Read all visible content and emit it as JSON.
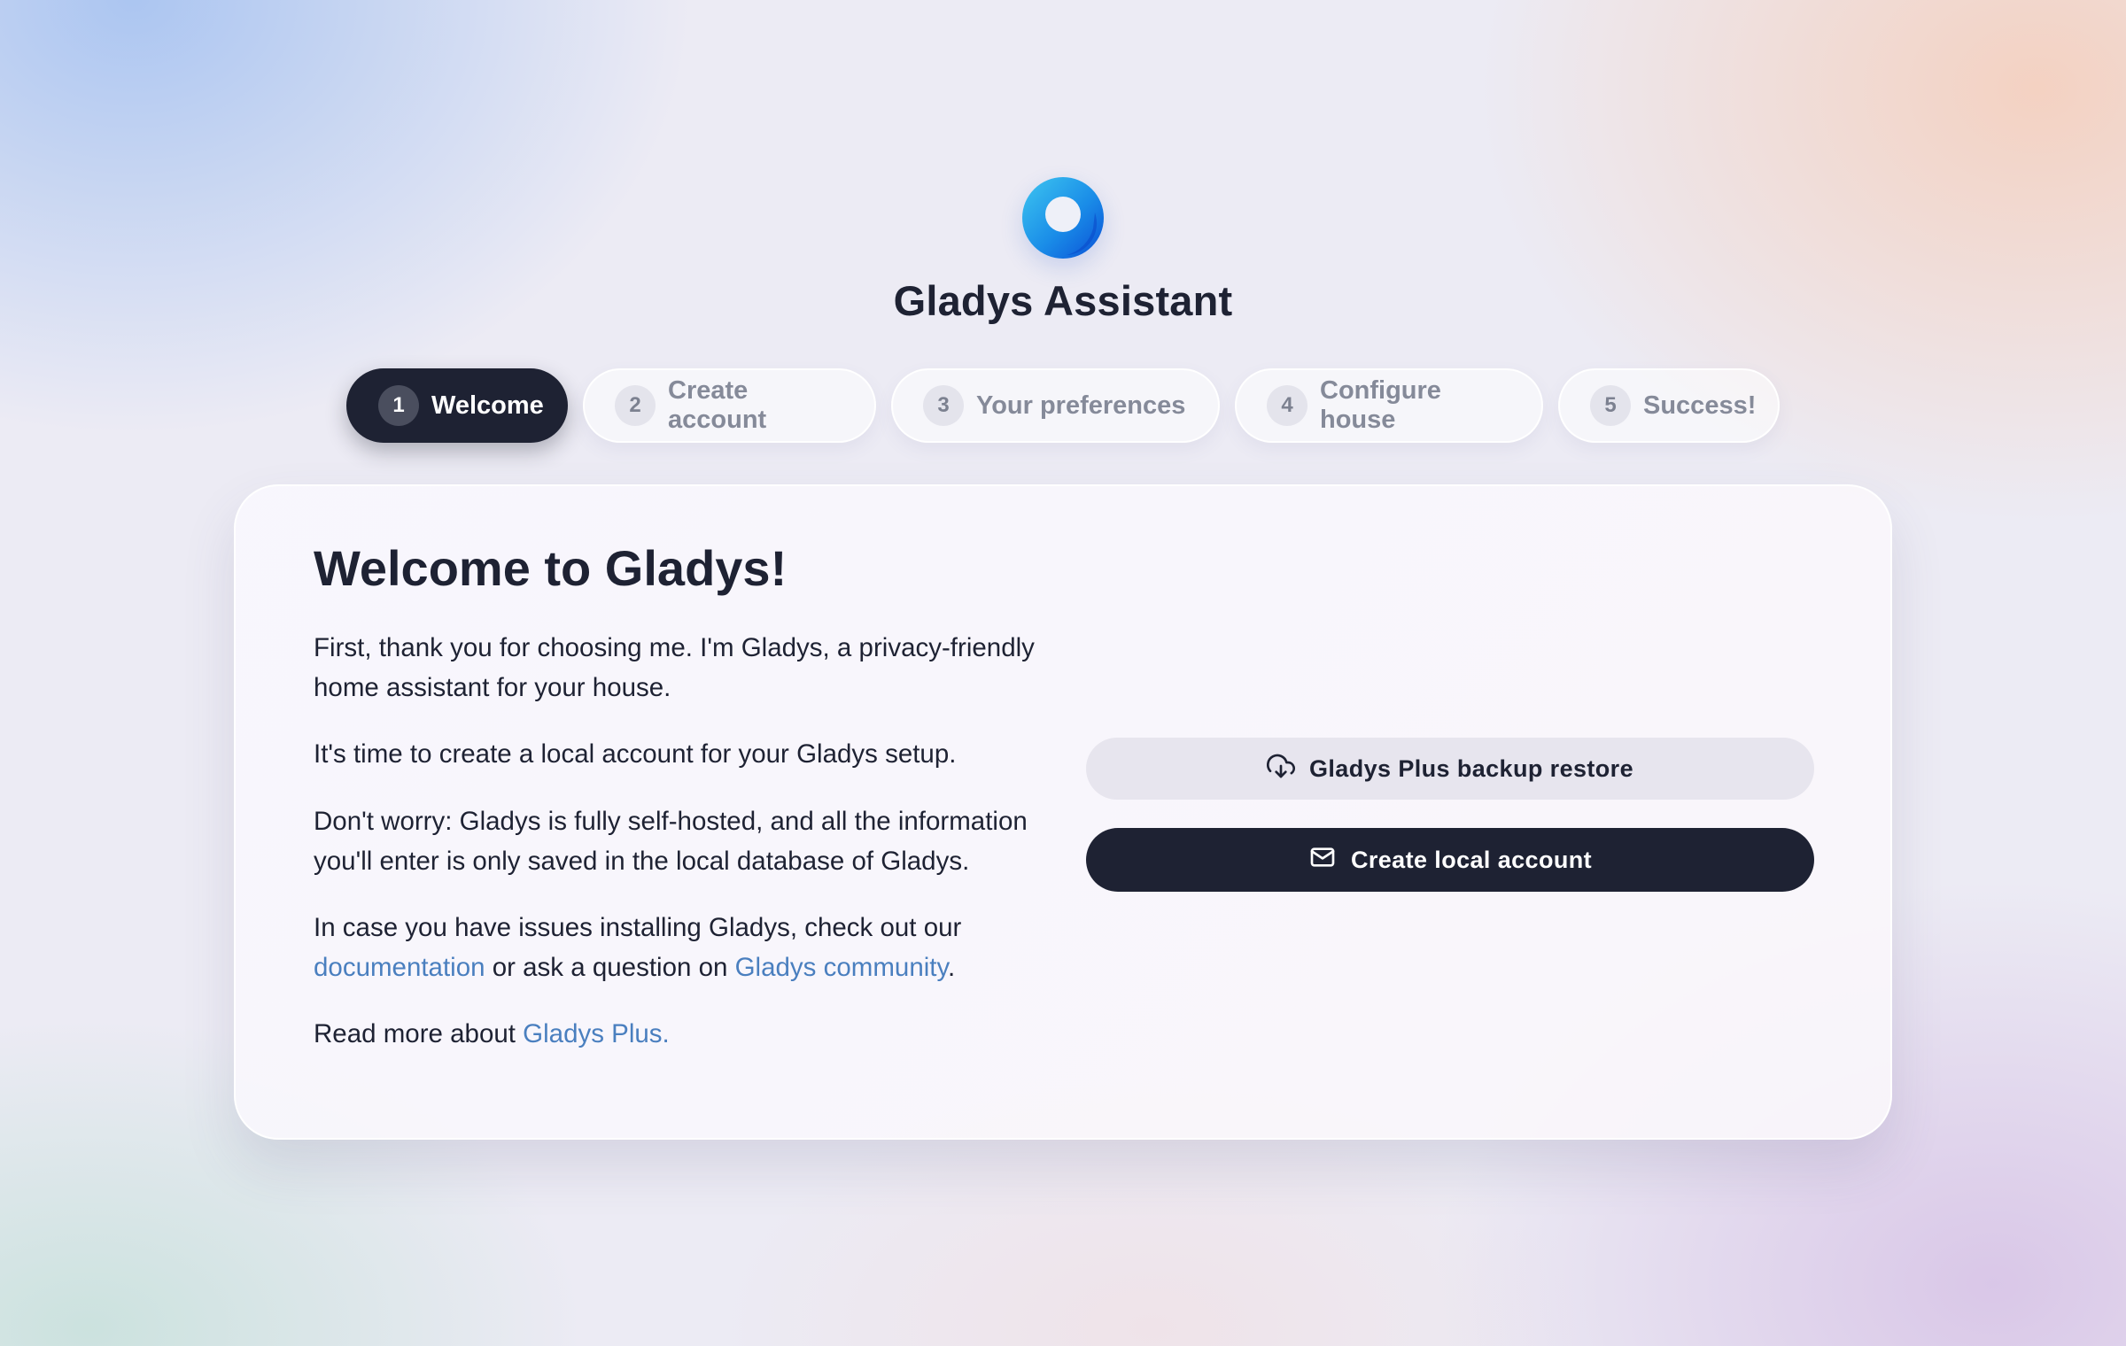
{
  "app": {
    "title": "Gladys Assistant",
    "logo_icon": "gladys-ring-logo",
    "logo_colors": [
      "#3ec6f0",
      "#1a73e8",
      "#0a4fd6"
    ]
  },
  "stepper": {
    "steps": [
      {
        "number": "1",
        "label": "Welcome",
        "active": true
      },
      {
        "number": "2",
        "label": "Create account",
        "active": false
      },
      {
        "number": "3",
        "label": "Your preferences",
        "active": false
      },
      {
        "number": "4",
        "label": "Configure house",
        "active": false
      },
      {
        "number": "5",
        "label": "Success!",
        "active": false
      }
    ]
  },
  "card": {
    "title": "Welcome to Gladys!",
    "paragraphs": {
      "intro": "First, thank you for choosing me. I'm Gladys, a privacy-friendly home assistant for your house.",
      "local_account": "It's time to create a local account for your Gladys setup.",
      "privacy": "Don't worry: Gladys is fully self-hosted, and all the information you'll enter is only saved in the local database of Gladys.",
      "help_prefix": "In case you have issues installing Gladys, check out our ",
      "help_link_docs": "documentation",
      "help_middle": " or ask a question on ",
      "help_link_community": "Gladys community",
      "help_suffix": ".",
      "plus_prefix": "Read more about ",
      "plus_link": "Gladys Plus."
    },
    "buttons": {
      "restore_label": "Gladys Plus backup restore",
      "restore_icon": "cloud-download-icon",
      "create_label": "Create local account",
      "create_icon": "mail-icon"
    }
  },
  "colors": {
    "primary_dark": "#1e2233",
    "link": "#4a7fbf",
    "secondary_button": "#e7e5ee",
    "inactive_step_text": "#858a99"
  }
}
